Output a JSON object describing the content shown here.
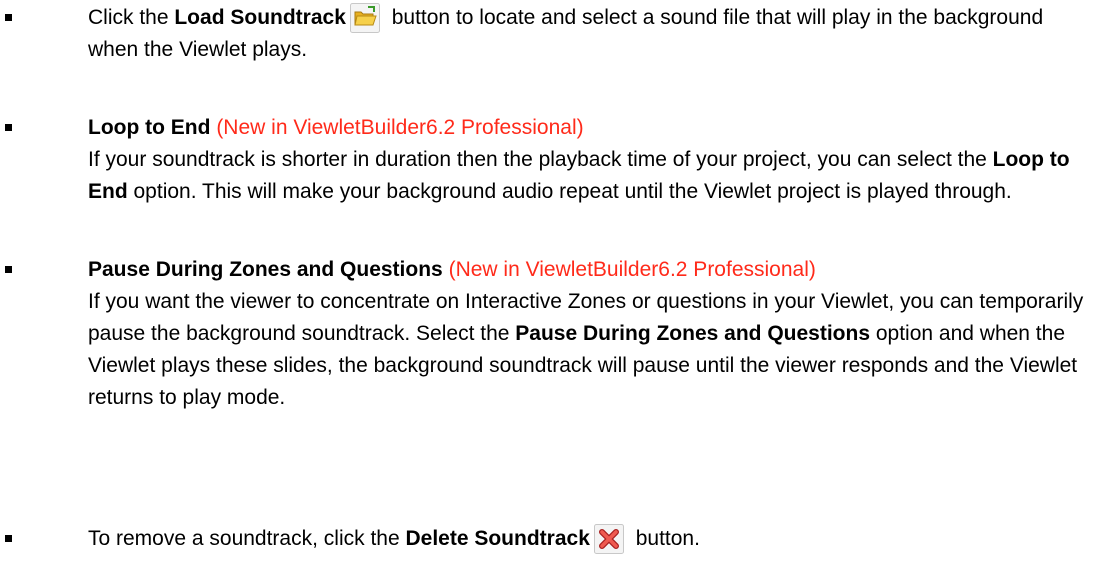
{
  "items": [
    {
      "pre": "Click the ",
      "bold": "Load Soundtrack",
      "icon": "folder-open-icon",
      "post": " button to locate and select a sound file that will play in the background when the Viewlet plays."
    },
    {
      "title": "Loop to End",
      "tag": "(New in ViewletBuilder6.2 Professional)",
      "body_pre": "If your soundtrack is shorter in duration then the playback time of your project, you can select the ",
      "body_bold": "Loop to End",
      "body_post": " option. This will make your background audio repeat until the Viewlet project is played through."
    },
    {
      "title": "Pause During Zones and Questions",
      "tag": "(New in ViewletBuilder6.2 Professional)",
      "body_pre": "If you want the viewer to concentrate on Interactive Zones or questions in your Viewlet, you can temporarily pause the background soundtrack. Select the ",
      "body_bold": "Pause During Zones and Questions",
      "body_post": " option and when the Viewlet plays these slides, the background soundtrack will pause until the viewer responds and the Viewlet returns to play mode."
    },
    {
      "pre": "To remove a soundtrack, click the ",
      "bold": "Delete Soundtrack",
      "icon": "delete-x-icon",
      "post": " button."
    }
  ],
  "colors": {
    "text": "#000000",
    "new_tag": "#ff2a1a",
    "folder": "#f2c230",
    "delete": "#e0413b"
  }
}
